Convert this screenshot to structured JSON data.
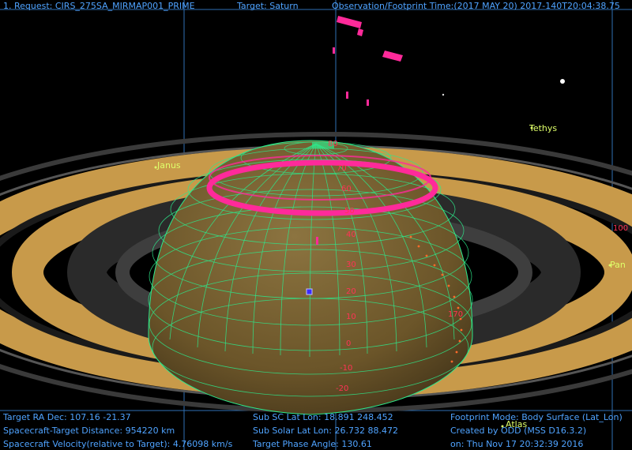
{
  "header": {
    "request": "1. Request: CIRS_275SA_MIRMAP001_PRIME",
    "target": "Target: Saturn",
    "observation_time": "Observation/Footprint Time:(2017 MAY 20) 2017-140T20:04:38.75"
  },
  "moons": {
    "janus": "Janus",
    "tethys": "Tethys",
    "pan": "Pan",
    "atlas": "Atlas"
  },
  "latitude_labels": {
    "l70": "70",
    "l60": "60",
    "l50": "50",
    "l40": "40",
    "l30": "30",
    "l20": "20",
    "l10": "10",
    "l0": "0",
    "lm10": "-10",
    "lm20": "-20",
    "l80": "80",
    "l100": "100",
    "l170": "170"
  },
  "footer": {
    "ra_dec": "Target RA Dec: 107.16   -21.37",
    "distance": "Spacecraft-Target Distance:  954220 km",
    "velocity": "Spacecraft Velocity(relative to Target): 4.76098 km/s",
    "sub_sc": "Sub SC Lat Lon: 18.891  248.452",
    "sub_solar": "Sub Solar Lat Lon: 26.732  88.472",
    "phase": "Target Phase Angle: 130.61",
    "footprint_mode": "Footprint Mode: Body Surface (Lat_Lon)",
    "created_by": "Created by ODD (MSS D16.3.2)",
    "created_on": "on: Thu Nov 17 20:32:39 2016"
  },
  "colors": {
    "background": "#000000",
    "info_text": "#4fa3ff",
    "moon_label": "#dfff6a",
    "grid": "#2ee88a",
    "footprint": "#ff2a9a",
    "ring_gold": "#c89a4a",
    "ring_gap": "#2a2a2a",
    "planet": "#6e5a2e",
    "latitude_label": "#ff3355"
  }
}
